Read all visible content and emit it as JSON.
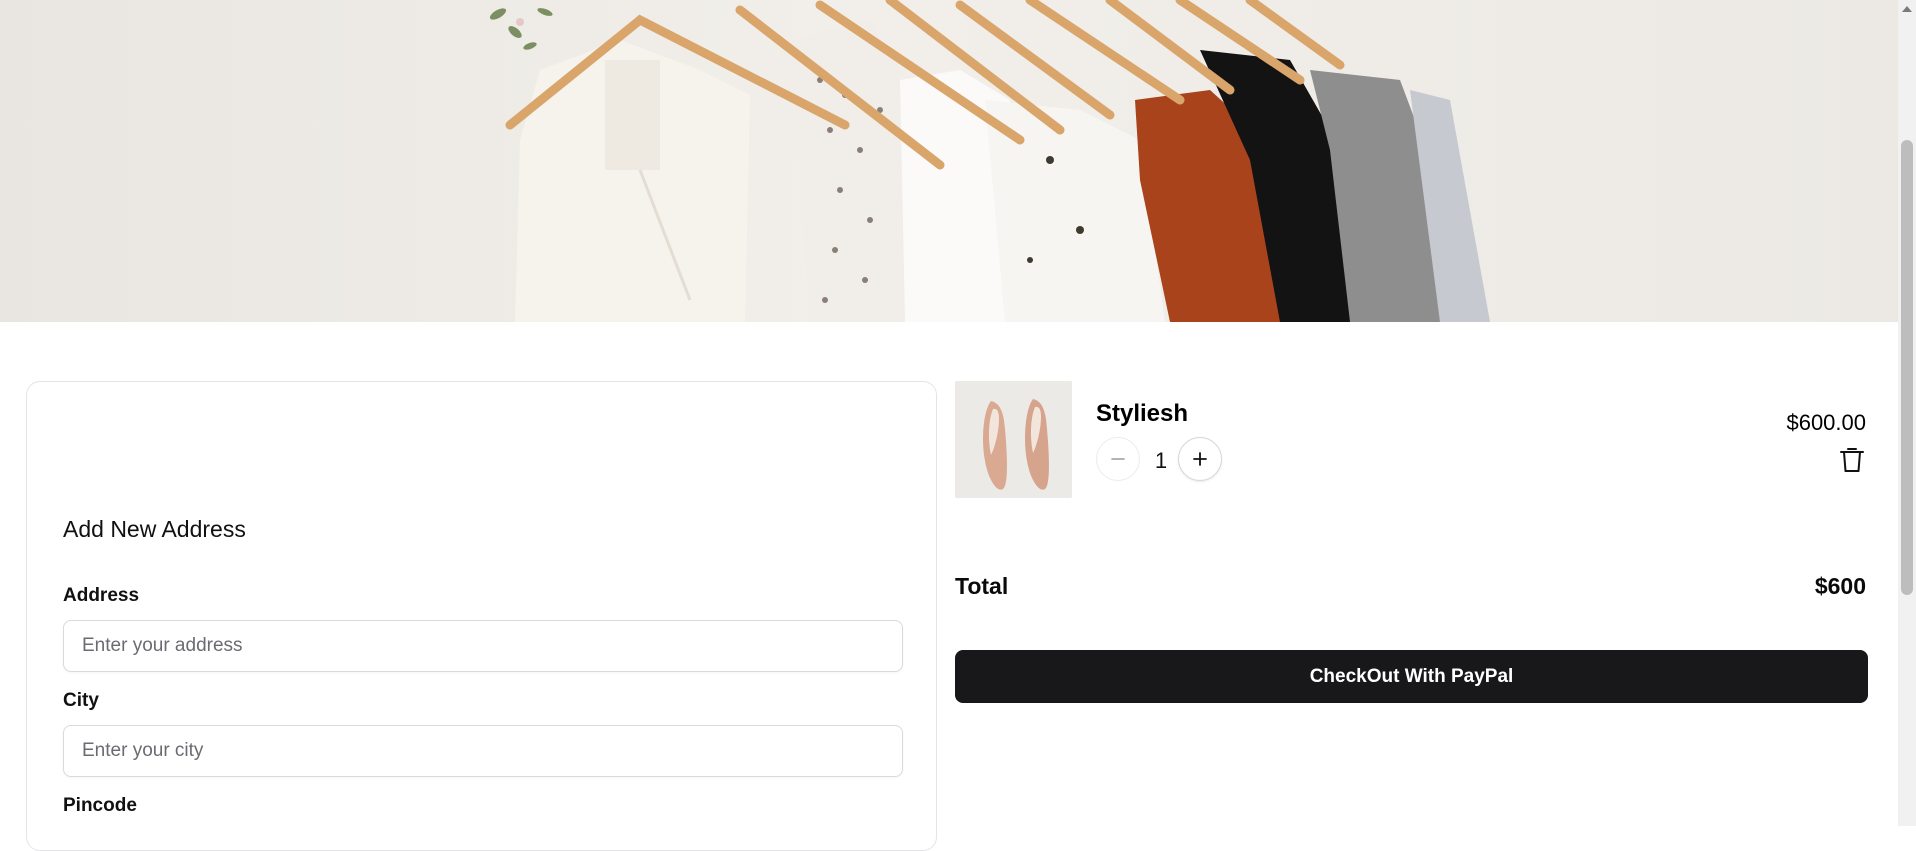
{
  "banner": {
    "image": "clothes-rack-hero"
  },
  "cart": {
    "item": {
      "name": "Styliesh",
      "quantity": "1",
      "price": "$600.00",
      "image": "nude-heels-photo"
    },
    "total_label": "Total",
    "total_value": "$600",
    "checkout_label": "CheckOut With PayPal"
  },
  "address_form": {
    "title": "Add New Address",
    "fields": [
      {
        "label": "Address",
        "placeholder": "Enter your address",
        "value": ""
      },
      {
        "label": "City",
        "placeholder": "Enter your city",
        "value": ""
      },
      {
        "label": "Pincode",
        "placeholder": "",
        "value": ""
      }
    ]
  },
  "colors": {
    "button_bg": "#18181b",
    "border": "#e4e4e7"
  }
}
